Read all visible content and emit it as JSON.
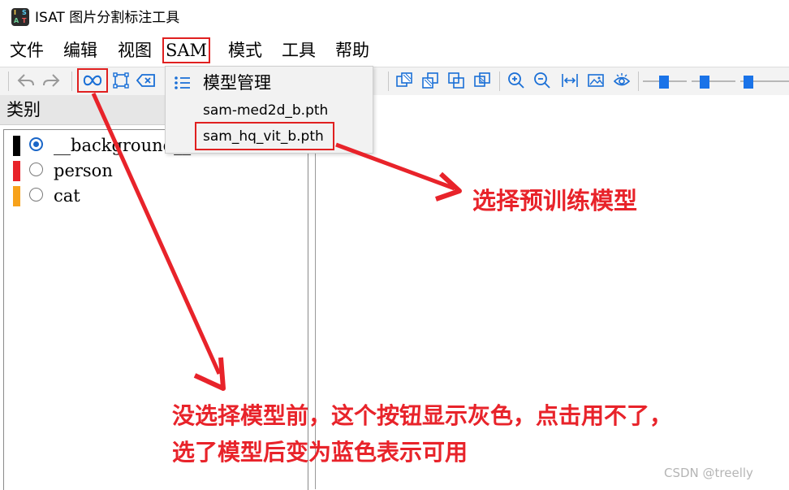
{
  "window": {
    "logo_letters": [
      "I",
      "S",
      "A",
      "T"
    ],
    "title": "ISAT 图片分割标注工具"
  },
  "menubar": {
    "items": [
      "文件",
      "编辑",
      "视图",
      "SAM",
      "模式",
      "工具",
      "帮助"
    ]
  },
  "sam_menu": {
    "header": "模型管理",
    "models": [
      "sam-med2d_b.pth",
      "sam_hq_vit_b.pth"
    ]
  },
  "left_panel": {
    "title": "类别",
    "classes": [
      {
        "label": "__background__",
        "color": "#000000",
        "selected": true
      },
      {
        "label": "person",
        "color": "#e8232a",
        "selected": false
      },
      {
        "label": "cat",
        "color": "#f7a21b",
        "selected": false
      }
    ]
  },
  "annotations": {
    "select_model": "选择预训练模型",
    "button_note_line1": "没选择模型前，这个按钮显示灰色，点击用不了，",
    "button_note_line2": "选了模型后变为蓝色表示可用",
    "color": "#e8232a"
  },
  "watermark": "CSDN @treelly",
  "colors": {
    "accent": "#1a6fd6",
    "highlight": "#e02020"
  }
}
